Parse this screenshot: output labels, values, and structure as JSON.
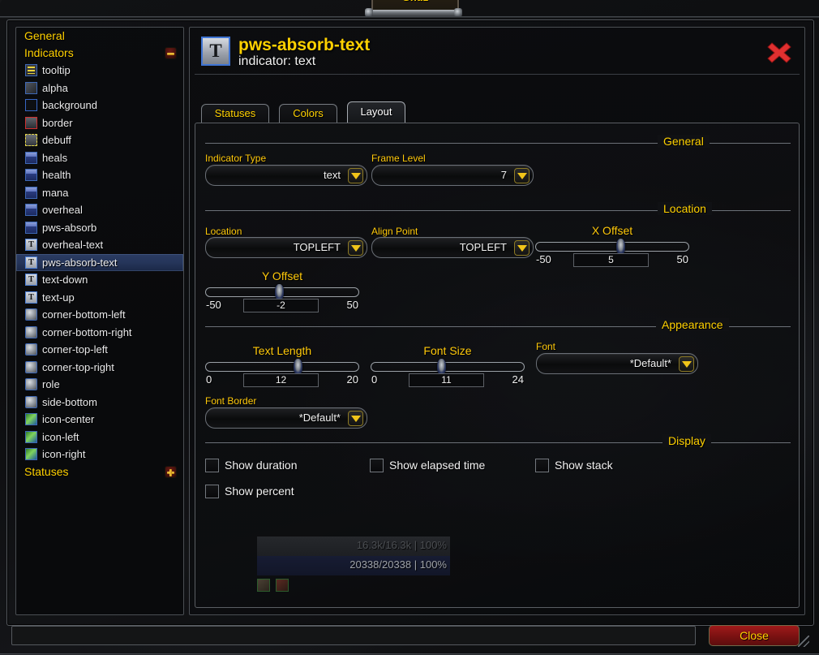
{
  "top_frame": {
    "label": "Ghdz"
  },
  "sidebar": {
    "groups": [
      {
        "label": "General",
        "toggle": null
      },
      {
        "label": "Indicators",
        "toggle": "minus"
      }
    ],
    "statuses_group": {
      "label": "Statuses",
      "toggle": "plus"
    },
    "items": [
      {
        "label": "tooltip",
        "icon": "tooltip-icon",
        "icon_class": "ico-tooltip",
        "glyph": ""
      },
      {
        "label": "alpha",
        "icon": "alpha-icon",
        "icon_class": "ico-alpha",
        "glyph": ""
      },
      {
        "label": "background",
        "icon": "background-icon",
        "icon_class": "ico-background",
        "glyph": ""
      },
      {
        "label": "border",
        "icon": "border-icon",
        "icon_class": "ico-border",
        "glyph": ""
      },
      {
        "label": "debuff",
        "icon": "debuff-icon",
        "icon_class": "ico-debuff",
        "glyph": ""
      },
      {
        "label": "heals",
        "icon": "bar-icon",
        "icon_class": "ico-bar",
        "glyph": ""
      },
      {
        "label": "health",
        "icon": "bar-icon",
        "icon_class": "ico-bar",
        "glyph": ""
      },
      {
        "label": "mana",
        "icon": "bar-icon",
        "icon_class": "ico-bar",
        "glyph": ""
      },
      {
        "label": "overheal",
        "icon": "bar-icon",
        "icon_class": "ico-bar",
        "glyph": ""
      },
      {
        "label": "pws-absorb",
        "icon": "bar-icon",
        "icon_class": "ico-bar",
        "glyph": ""
      },
      {
        "label": "overheal-text",
        "icon": "text-icon",
        "icon_class": "ico-text",
        "glyph": "T"
      },
      {
        "label": "pws-absorb-text",
        "icon": "text-icon",
        "icon_class": "ico-text",
        "glyph": "T",
        "selected": true
      },
      {
        "label": "text-down",
        "icon": "text-icon",
        "icon_class": "ico-text",
        "glyph": "T"
      },
      {
        "label": "text-up",
        "icon": "text-icon",
        "icon_class": "ico-text",
        "glyph": "T"
      },
      {
        "label": "corner-bottom-left",
        "icon": "corner-icon",
        "icon_class": "ico-corner",
        "glyph": ""
      },
      {
        "label": "corner-bottom-right",
        "icon": "corner-icon",
        "icon_class": "ico-corner",
        "glyph": ""
      },
      {
        "label": "corner-top-left",
        "icon": "corner-icon",
        "icon_class": "ico-corner",
        "glyph": ""
      },
      {
        "label": "corner-top-right",
        "icon": "corner-icon",
        "icon_class": "ico-corner",
        "glyph": ""
      },
      {
        "label": "role",
        "icon": "corner-icon",
        "icon_class": "ico-corner",
        "glyph": ""
      },
      {
        "label": "side-bottom",
        "icon": "corner-icon",
        "icon_class": "ico-corner",
        "glyph": ""
      },
      {
        "label": "icon-center",
        "icon": "image-icon",
        "icon_class": "ico-iconimg",
        "glyph": ""
      },
      {
        "label": "icon-left",
        "icon": "image-icon",
        "icon_class": "ico-iconimg",
        "glyph": ""
      },
      {
        "label": "icon-right",
        "icon": "image-icon",
        "icon_class": "ico-iconimg",
        "glyph": ""
      }
    ]
  },
  "panel": {
    "icon_glyph": "T",
    "title": "pws-absorb-text",
    "subtitle": "indicator: text",
    "close_icon": "close-icon",
    "tabs": [
      {
        "label": "Statuses",
        "active": false
      },
      {
        "label": "Colors",
        "active": false
      },
      {
        "label": "Layout",
        "active": true
      }
    ]
  },
  "sections": {
    "general": {
      "title": "General",
      "indicator_type": {
        "label": "Indicator Type",
        "value": "text"
      },
      "frame_level": {
        "label": "Frame Level",
        "value": "7"
      }
    },
    "location": {
      "title": "Location",
      "location": {
        "label": "Location",
        "value": "TOPLEFT"
      },
      "align_point": {
        "label": "Align Point",
        "value": "TOPLEFT"
      },
      "x_offset": {
        "label": "X Offset",
        "value": "5",
        "min": "-50",
        "max": "50",
        "min_num": -50,
        "max_num": 50,
        "num": 5
      },
      "y_offset": {
        "label": "Y Offset",
        "value": "-2",
        "min": "-50",
        "max": "50",
        "min_num": -50,
        "max_num": 50,
        "num": -2
      }
    },
    "appearance": {
      "title": "Appearance",
      "text_length": {
        "label": "Text Length",
        "value": "12",
        "min": "0",
        "max": "20",
        "min_num": 0,
        "max_num": 20,
        "num": 12
      },
      "font_size": {
        "label": "Font Size",
        "value": "11",
        "min": "0",
        "max": "24",
        "min_num": 0,
        "max_num": 24,
        "num": 11
      },
      "font": {
        "label": "Font",
        "value": "*Default*"
      },
      "font_border": {
        "label": "Font Border",
        "value": "*Default*"
      }
    },
    "display": {
      "title": "Display",
      "checkboxes": [
        {
          "label": "Show duration",
          "checked": false
        },
        {
          "label": "Show elapsed time",
          "checked": false
        },
        {
          "label": "Show stack",
          "checked": false
        },
        {
          "label": "Show percent",
          "checked": false
        }
      ]
    }
  },
  "preview": {
    "bar1_text": "16.3k/16.3k | 100%",
    "bar2_text": "20338/20338 | 100%"
  },
  "footer": {
    "status_value": "",
    "status_placeholder": "",
    "close_label": "Close"
  },
  "colors": {
    "accent_gold": "#ffd100",
    "label_gold": "#ffc90a",
    "selection_blue": "#2b3c63",
    "close_red": "#a01a1a",
    "x_red": "#e03030"
  }
}
